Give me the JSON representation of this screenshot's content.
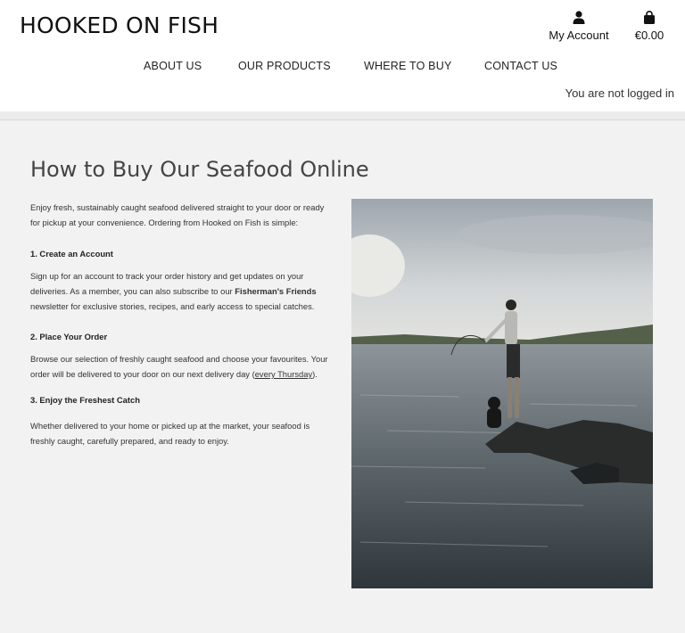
{
  "header": {
    "logo": "HOOKED ON FISH",
    "account_label": "My Account",
    "cart_total": "€0.00",
    "login_status": "You are not logged in"
  },
  "nav": {
    "items": [
      {
        "label": "ABOUT US"
      },
      {
        "label": "OUR PRODUCTS"
      },
      {
        "label": "WHERE TO BUY"
      },
      {
        "label": "CONTACT US"
      }
    ]
  },
  "main": {
    "title": "How to Buy Our Seafood Online",
    "intro": "Enjoy fresh, sustainably caught seafood delivered straight to your door or ready for pickup at your convenience. Ordering from Hooked on Fish is simple:",
    "steps": [
      {
        "heading": "1. Create an Account",
        "text_before": "Sign up for an account to track your order history and get updates on your deliveries. As a member, you can also subscribe to our ",
        "bold": "Fisherman's Friends",
        "text_after": " newsletter for exclusive stories, recipes, and early access to special catches."
      },
      {
        "heading": "2. Place Your Order",
        "text_before": "Browse our selection of freshly caught seafood and choose your favourites. Your order will be delivered to your door on our next delivery day (",
        "link": "every Thursday",
        "text_after": ")."
      },
      {
        "heading": "3. Enjoy the Freshest Catch",
        "text": "Whether delivered to your home or picked up at the market, your seafood is freshly caught, carefully prepared, and ready to enjoy."
      }
    ]
  },
  "icons": {
    "account": "user-icon",
    "cart": "shopping-bag-icon"
  }
}
